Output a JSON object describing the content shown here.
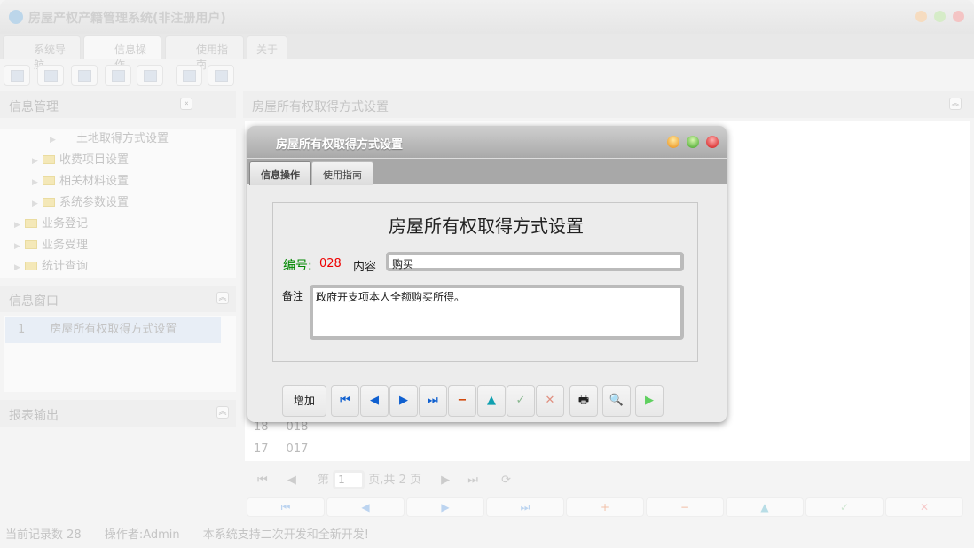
{
  "app": {
    "title": "房屋产权产籍管理系统(非注册用户)"
  },
  "main_tabs": [
    {
      "label": "系统导航"
    },
    {
      "label": "信息操作"
    },
    {
      "label": "使用指南"
    },
    {
      "label": "关于"
    }
  ],
  "left": {
    "info_mgmt": "信息管理",
    "tree": [
      {
        "label": "土地取得方式设置"
      },
      {
        "label": "收费项目设置"
      },
      {
        "label": "相关材料设置"
      },
      {
        "label": "系统参数设置"
      },
      {
        "label": "业务登记"
      },
      {
        "label": "业务受理"
      },
      {
        "label": "统计查询"
      }
    ],
    "info_window": "信息窗口",
    "windows": [
      {
        "index": "1",
        "label": "房屋所有权取得方式设置"
      }
    ],
    "report": "报表输出"
  },
  "content": {
    "title": "房屋所有权取得方式设置",
    "rows": [
      {
        "no": "18",
        "code": "018"
      },
      {
        "no": "17",
        "code": "017"
      }
    ],
    "pager": {
      "prefix": "第",
      "page": "1",
      "suffix": "页,共 2 页"
    }
  },
  "status": {
    "records": "当前记录数 28",
    "operator": "操作者:Admin",
    "note": "本系统支持二次开发和全新开发!"
  },
  "modal": {
    "title": "房屋所有权取得方式设置",
    "tabs": [
      {
        "label": "信息操作"
      },
      {
        "label": "使用指南"
      }
    ],
    "heading": "房屋所有权取得方式设置",
    "code_label": "编号:",
    "code_value": "028",
    "content_label": "内容",
    "content_value": "购买",
    "remark_label": "备注",
    "remark_value": "政府开支项本人全额购买所得。",
    "add_label": "增加"
  }
}
